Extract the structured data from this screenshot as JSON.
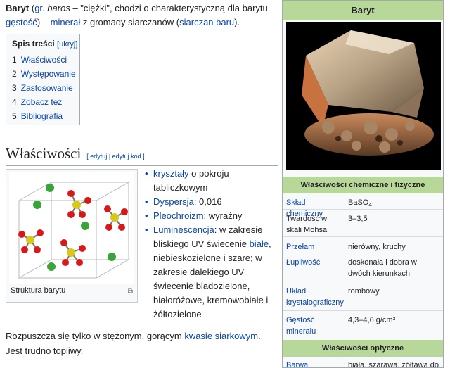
{
  "intro": {
    "term": "Baryt",
    "etym_open": " (",
    "etym_gr": "gr.",
    "etym_space": " ",
    "etym_word": "baros",
    "etym_rest": " – \"ciężki\", chodzi o charakterystyczną dla barytu",
    "gestosc": "gęstość",
    "rest1": ") – ",
    "mineral": "minerał",
    "rest2": " z gromady siarczanów (",
    "siarczan": "siarczan baru",
    "rest3": ")."
  },
  "toc": {
    "title": "Spis treści",
    "hide": "[ukryj]",
    "items": [
      {
        "num": "1",
        "label": "Właściwości"
      },
      {
        "num": "2",
        "label": "Występowanie"
      },
      {
        "num": "3",
        "label": "Zastosowanie"
      },
      {
        "num": "4",
        "label": "Zobacz też"
      },
      {
        "num": "5",
        "label": "Bibliografia"
      }
    ]
  },
  "section": {
    "title": "Właściwości",
    "edit": "[ edytuj | edytuj kod ]"
  },
  "thumb": {
    "caption": "Struktura barytu",
    "enlarge": "⧉"
  },
  "props": {
    "p1_link": "kryształy",
    "p1_text": " o pokroju tabliczkowym",
    "p2_link": "Dyspersja",
    "p2_text": ": 0,016",
    "p3_link": "Pleochroizm",
    "p3_text": ": wyraźny",
    "p4_link": "Luminescencja",
    "p4_text_a": ": w zakresie bliskiego UV świecenie ",
    "p4_link2": "białe",
    "p4_text_b": ", niebieskozielone i szare; w zakresie dalekiego UV świecenie bladozielone, białoróżowe, kremowobiałe i żółtozielone"
  },
  "para": {
    "text_a": "Rozpuszcza się tylko w stężonym, gorącym ",
    "link": "kwasie siarkowym",
    "text_b": ". Jest trudno topliwy."
  },
  "infobox": {
    "title": "Baryt",
    "sec_chem": "Właściwości chemiczne i fizyczne",
    "rows": [
      {
        "k": "Skład chemiczny",
        "v": "BaSO4"
      },
      {
        "k": "Twardość w skali Mohsa",
        "v": "3–3,5"
      },
      {
        "k": "Przełam",
        "v": "nierówny, kruchy"
      },
      {
        "k": "Łupliwość",
        "v": "doskonała i dobra w dwóch kierunkach"
      },
      {
        "k": "Układ krystalograficzny",
        "v": "rombowy"
      },
      {
        "k": "Gęstość minerału",
        "v": "4,3–4,6 g/cm³"
      }
    ],
    "sec_opt": "Właściwości optyczne",
    "opt_rows": [
      {
        "k": "Barwa",
        "v": "biała, szarawa, żółtawa do"
      }
    ]
  },
  "colors": {
    "link": "#0645ad",
    "infobox_header": "#b8d89a",
    "barium": "#3aa33a",
    "sulfur": "#d8c81c",
    "oxygen": "#d61a1a"
  }
}
